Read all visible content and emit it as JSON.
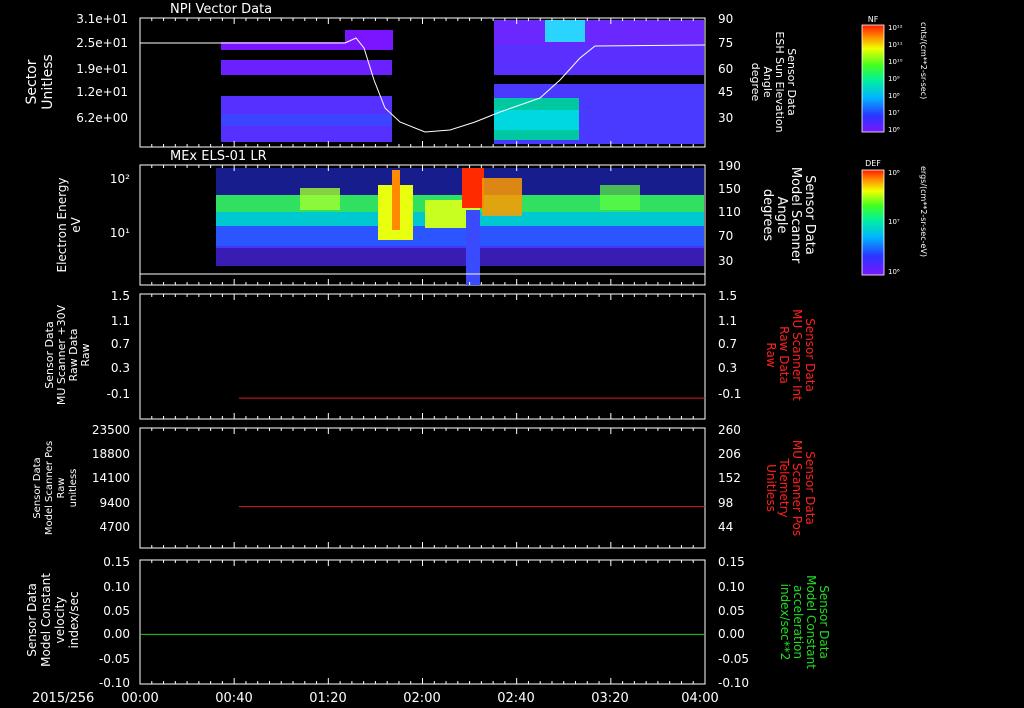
{
  "figure": {
    "date_label": "2015/256",
    "time_ticks": [
      "00:00",
      "00:40",
      "01:20",
      "02:00",
      "02:40",
      "03:20",
      "04:00"
    ]
  },
  "colors": {
    "axis": "#ffffff",
    "trace_white": "#ffffff",
    "trace_red": "#d42020",
    "trace_green": "#22cc22",
    "label_red": "#ff2020",
    "label_green": "#22dd22"
  },
  "chart_data": [
    {
      "type": "heatmap",
      "title": "NPI Vector Data",
      "ylabel": [
        "Sector",
        "Unitless"
      ],
      "y_ticks": [
        "3.1e+01",
        "2.5e+01",
        "1.9e+01",
        "1.2e+01",
        "6.2e+00"
      ],
      "right_ylabel": [
        "Sensor Data",
        "ESH Sun Elevation",
        "Angle",
        "degree"
      ],
      "right_y_ticks": [
        "90",
        "75",
        "60",
        "45",
        "30"
      ],
      "colorbar": {
        "name": "NF",
        "ticks": [
          "10¹²",
          "10¹¹",
          "10¹⁰",
          "10⁹",
          "10⁸",
          "10⁷",
          "10⁶"
        ],
        "label": "cnts/(cm**2-sr-sec)"
      },
      "overlay_line": {
        "x_hours": [
          0.0,
          0.85,
          1.0,
          1.3,
          1.45,
          1.7,
          2.0,
          2.2,
          2.5,
          2.8,
          3.0,
          3.2,
          3.4,
          4.0
        ],
        "y_degrees": [
          75,
          75,
          75,
          76,
          55,
          30,
          22,
          23,
          35,
          43,
          52,
          70,
          75,
          75
        ]
      }
    },
    {
      "type": "heatmap",
      "title": "MEx ELS-01 LR",
      "ylabel": [
        "Electron Energy",
        "eV"
      ],
      "y_ticks": [
        "10²",
        "10¹"
      ],
      "right_ylabel": [
        "Sensor Data",
        "Model Scanner",
        "Angle",
        "degrees"
      ],
      "right_y_ticks": [
        "190",
        "150",
        "110",
        "70",
        "30"
      ],
      "colorbar": {
        "name": "DEF",
        "ticks": [
          "10⁸",
          "10⁷",
          "10⁶"
        ],
        "label": "ergs/(cm**2-sr-sec-eV)"
      },
      "overlay_line": {
        "x_hours": [
          0.0,
          4.0
        ],
        "y_degrees": [
          10,
          10
        ]
      }
    },
    {
      "type": "line",
      "ylabel": [
        "Sensor Data",
        "MU Scanner +30V",
        "Raw Data",
        "Raw"
      ],
      "y_ticks": [
        "1.5",
        "1.1",
        "0.7",
        "0.3",
        "-0.1"
      ],
      "right_ylabel": [
        "Sensor Data",
        "MU Scanner Int",
        "Raw Data",
        "Raw"
      ],
      "right_y_ticks": [
        "1.5",
        "1.1",
        "0.7",
        "0.3",
        "-0.1"
      ],
      "ylim": [
        -0.3,
        1.5
      ],
      "series": [
        {
          "x_hours": [
            0.7,
            4.0
          ],
          "values": [
            0.0,
            0.0
          ]
        }
      ]
    },
    {
      "type": "line",
      "ylabel": [
        "Sensor Data",
        "Model Scanner Pos",
        "Raw",
        "unitless"
      ],
      "y_ticks": [
        "23500",
        "18800",
        "14100",
        "9400",
        "4700"
      ],
      "right_ylabel": [
        "Sensor Data",
        "MU Scanner Pos",
        "Telemetry",
        "Unitless"
      ],
      "right_y_ticks": [
        "260",
        "206",
        "152",
        "98",
        "44"
      ],
      "ylim": [
        0,
        23500
      ],
      "series": [
        {
          "x_hours": [
            0.7,
            4.0
          ],
          "values": [
            8100,
            8100
          ]
        }
      ]
    },
    {
      "type": "line",
      "ylabel": [
        "Sensor Data",
        "Model Constant",
        "velocity",
        "index/sec"
      ],
      "y_ticks": [
        "0.15",
        "0.10",
        "0.05",
        "0.00",
        "-0.05",
        "-0.10"
      ],
      "right_ylabel": [
        "Sensor Data",
        "Model Constant",
        "acceleration",
        "index/sec**2"
      ],
      "right_y_ticks": [
        "0.15",
        "0.10",
        "0.05",
        "0.00",
        "-0.05",
        "-0.10"
      ],
      "ylim": [
        -0.1,
        0.15
      ],
      "series": [
        {
          "x_hours": [
            0.0,
            4.0
          ],
          "values": [
            0.0,
            0.0
          ]
        }
      ]
    }
  ]
}
